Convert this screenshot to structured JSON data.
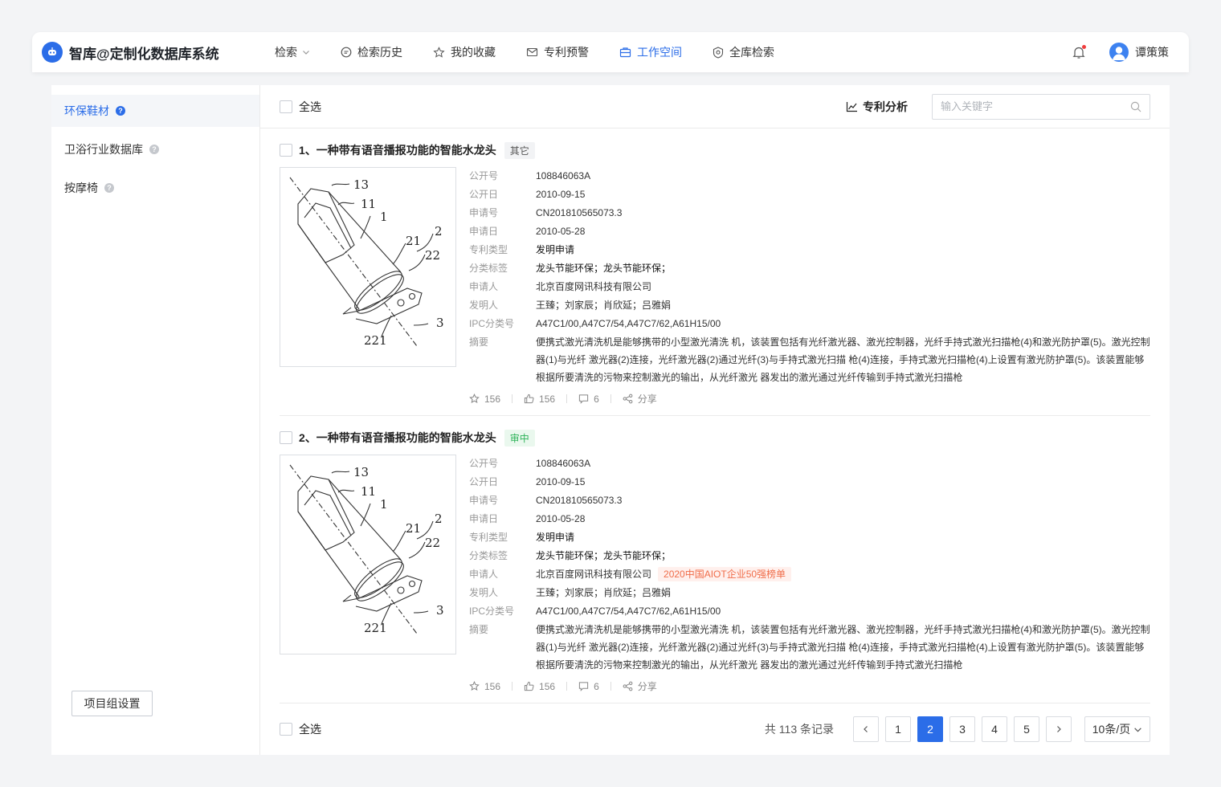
{
  "app": {
    "title": "智库@定制化数据库系统"
  },
  "nav": [
    {
      "label": "检索",
      "icon": "chevron-down-icon"
    },
    {
      "label": "检索历史",
      "icon": "history-icon"
    },
    {
      "label": "我的收藏",
      "icon": "star-icon"
    },
    {
      "label": "专利预警",
      "icon": "mail-alert-icon"
    },
    {
      "label": "工作空间",
      "icon": "briefcase-icon",
      "active": true
    },
    {
      "label": "全库检索",
      "icon": "shield-search-icon"
    }
  ],
  "user": {
    "name": "谭策策"
  },
  "sidebar": {
    "items": [
      {
        "label": "环保鞋材",
        "active": true
      },
      {
        "label": "卫浴行业数据库"
      },
      {
        "label": "按摩椅"
      }
    ],
    "settings_button": "项目组设置"
  },
  "toolbar": {
    "select_all": "全选",
    "analysis": "专利分析",
    "search_placeholder": "输入关键字"
  },
  "field_labels": {
    "pub_no": "公开号",
    "pub_date": "公开日",
    "app_no": "申请号",
    "app_date": "申请日",
    "type": "专利类型",
    "category": "分类标签",
    "applicant": "申请人",
    "inventor": "发明人",
    "ipc": "IPC分类号",
    "abstract": "摘要"
  },
  "items": [
    {
      "title": "1、一种带有语音播报功能的智能水龙头",
      "tag": "其它",
      "pub_no": "108846063A",
      "pub_date": "2010-09-15",
      "app_no": "CN201810565073.3",
      "app_date": "2010-05-28",
      "type": "发明申请",
      "category": "龙头节能环保；龙头节能环保；",
      "applicant": "北京百度网讯科技有限公司",
      "applicant_badge": "",
      "inventor": "王臻；刘家辰；肖欣延；吕雅娟",
      "ipc": "A47C1/00,A47C7/54,A47C7/62,A61H15/00",
      "abstract": "便携式激光清洗机是能够携带的小型激光清洗 机，该装置包括有光纤激光器、激光控制器，光纤手持式激光扫描枪(4)和激光防护罩(5)。激光控制器(1)与光纤 激光器(2)连接，光纤激光器(2)通过光纤(3)与手持式激光扫描 枪(4)连接，手持式激光扫描枪(4)上设置有激光防护罩(5)。该装置能够根据所要清洗的污物来控制激光的输出，从光纤激光 器发出的激光通过光纤传输到手持式激光扫描枪",
      "favorites": "156",
      "likes": "156",
      "comments": "6",
      "share": "分享",
      "figure_labels": [
        "13",
        "11",
        "1",
        "2",
        "21",
        "22",
        "3",
        "221"
      ]
    },
    {
      "title": "2、一种带有语音播报功能的智能水龙头",
      "tag": "审中",
      "pub_no": "108846063A",
      "pub_date": "2010-09-15",
      "app_no": "CN201810565073.3",
      "app_date": "2010-05-28",
      "type": "发明申请",
      "category": "龙头节能环保；龙头节能环保；",
      "applicant": "北京百度网讯科技有限公司",
      "applicant_badge": "2020中国AIOT企业50强榜单",
      "inventor": "王臻；刘家辰；肖欣延；吕雅娟",
      "ipc": "A47C1/00,A47C7/54,A47C7/62,A61H15/00",
      "abstract": "便携式激光清洗机是能够携带的小型激光清洗 机，该装置包括有光纤激光器、激光控制器，光纤手持式激光扫描枪(4)和激光防护罩(5)。激光控制器(1)与光纤 激光器(2)连接，光纤激光器(2)通过光纤(3)与手持式激光扫描 枪(4)连接，手持式激光扫描枪(4)上设置有激光防护罩(5)。该装置能够根据所要清洗的污物来控制激光的输出，从光纤激光 器发出的激光通过光纤传输到手持式激光扫描枪",
      "favorites": "156",
      "likes": "156",
      "comments": "6",
      "share": "分享",
      "figure_labels": [
        "13",
        "11",
        "1",
        "2",
        "21",
        "22",
        "3",
        "221"
      ]
    }
  ],
  "footer": {
    "select_all": "全选",
    "total": "共 113 条记录",
    "pages": [
      "1",
      "2",
      "3",
      "4",
      "5"
    ],
    "current_page": "2",
    "page_size": "10条/页"
  },
  "colors": {
    "accent": "#2b6de8",
    "badge": "#f06d4a",
    "tag_green": "#2fb35a"
  }
}
